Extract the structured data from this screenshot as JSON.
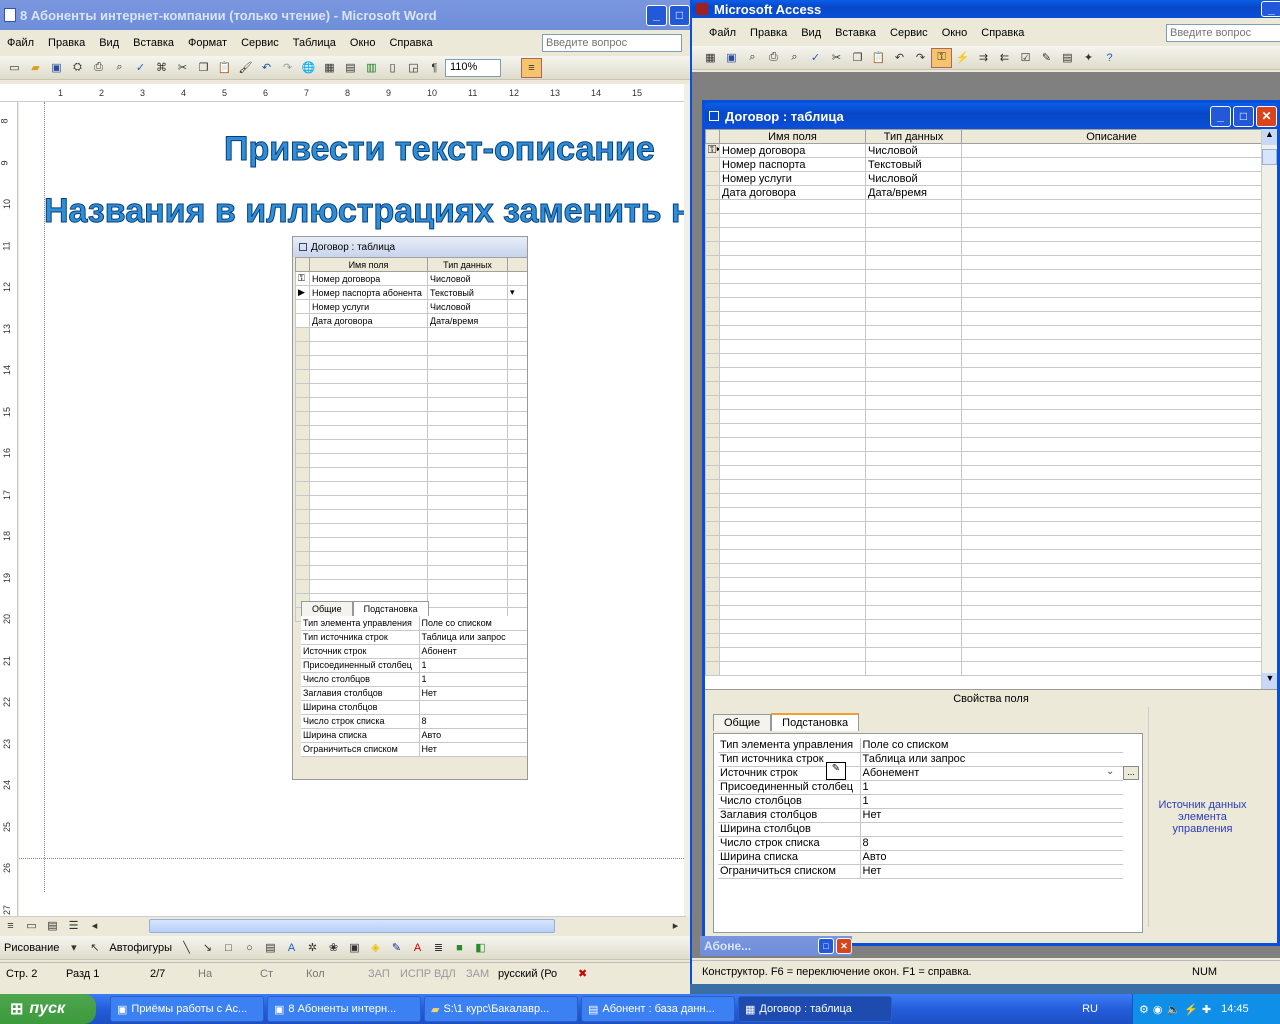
{
  "word": {
    "title": "8 Абоненты интернет-компании  (только чтение) - Microsoft Word",
    "menu": [
      "Файл",
      "Правка",
      "Вид",
      "Вставка",
      "Формат",
      "Сервис",
      "Таблица",
      "Окно",
      "Справка"
    ],
    "ask_placeholder": "Введите вопрос",
    "zoom": "110%",
    "heading1": "Привести текст-описание",
    "heading2": "Названия в иллюстрациях заменить на реа",
    "ruler_nums": [
      "1",
      "2",
      "3",
      "4",
      "5",
      "6",
      "7",
      "8",
      "9",
      "10",
      "11",
      "12",
      "13",
      "14",
      "15"
    ],
    "vruler_nums": [
      "8",
      "9",
      "10",
      "11",
      "12",
      "13",
      "14",
      "15",
      "16",
      "17",
      "18",
      "19",
      "20",
      "21",
      "22",
      "23",
      "24",
      "25",
      "26",
      "27"
    ],
    "embedded": {
      "title": "Договор : таблица",
      "col1": "Имя поля",
      "col2": "Тип данных",
      "rows": [
        {
          "name": "Номер договора",
          "type": "Числовой"
        },
        {
          "name": "Номер паспорта абонента",
          "type": "Текстовый"
        },
        {
          "name": "Номер услуги",
          "type": "Числовой"
        },
        {
          "name": "Дата договора",
          "type": "Дата/время"
        }
      ],
      "tab_general": "Общие",
      "tab_lookup": "Подстановка",
      "props": [
        {
          "k": "Тип элемента управления",
          "v": "Поле со списком"
        },
        {
          "k": "Тип источника строк",
          "v": "Таблица или запрос"
        },
        {
          "k": "Источник строк",
          "v": "Абонент"
        },
        {
          "k": "Присоединенный столбец",
          "v": "1"
        },
        {
          "k": "Число столбцов",
          "v": "1"
        },
        {
          "k": "Заглавия столбцов",
          "v": "Нет"
        },
        {
          "k": "Ширина столбцов",
          "v": ""
        },
        {
          "k": "Число строк списка",
          "v": "8"
        },
        {
          "k": "Ширина списка",
          "v": "Авто"
        },
        {
          "k": "Ограничиться списком",
          "v": "Нет"
        }
      ]
    },
    "drawing": "Рисование",
    "autoshapes": "Автофигуры",
    "status": [
      "Стр.  2",
      "Разд  1",
      "2/7",
      "На",
      "Ст",
      "Кол",
      "ЗАП",
      "ИСПР",
      "ВДЛ",
      "ЗАМ",
      "русский (Ро"
    ]
  },
  "access": {
    "title": "Microsoft Access",
    "menu": [
      "Файл",
      "Правка",
      "Вид",
      "Вставка",
      "Сервис",
      "Окно",
      "Справка"
    ],
    "ask_placeholder": "Введите вопрос",
    "table": {
      "title": "Договор : таблица",
      "col1": "Имя поля",
      "col2": "Тип данных",
      "col3": "Описание",
      "rows": [
        {
          "name": "Номер договора",
          "type": "Числовой"
        },
        {
          "name": "Номер паспорта",
          "type": "Текстовый"
        },
        {
          "name": "Номер услуги",
          "type": "Числовой"
        },
        {
          "name": "Дата договора",
          "type": "Дата/время"
        }
      ],
      "props_header": "Свойства поля",
      "tab_general": "Общие",
      "tab_lookup": "Подстановка",
      "props": [
        {
          "k": "Тип элемента управления",
          "v": "Поле со списком"
        },
        {
          "k": "Тип источника строк",
          "v": "Таблица или запрос"
        },
        {
          "k": "Источник строк",
          "v": "Абонемент"
        },
        {
          "k": "Присоединенный столбец",
          "v": "1"
        },
        {
          "k": "Число столбцов",
          "v": "1"
        },
        {
          "k": "Заглавия столбцов",
          "v": "Нет"
        },
        {
          "k": "Ширина столбцов",
          "v": ""
        },
        {
          "k": "Число строк списка",
          "v": "8"
        },
        {
          "k": "Ширина списка",
          "v": "Авто"
        },
        {
          "k": "Ограничиться списком",
          "v": "Нет"
        }
      ],
      "hint": "Источник данных элемента управления"
    },
    "minimized": "Абоне...",
    "status": "Конструктор.  F6 = переключение окон.  F1 = справка.",
    "num": "NUM"
  },
  "taskbar": {
    "start": "пуск",
    "buttons": [
      "Приёмы работы с Ас...",
      "8 Абоненты интерн...",
      "S:\\1 курс\\Бакалавр...",
      "Абонент : база данн...",
      "Договор : таблица"
    ],
    "lang": "RU",
    "clock": "14:45"
  },
  "colors": {
    "title_blue": "#0a4fd8",
    "taskbar": "#245edb",
    "start_green": "#3c9a3c",
    "heading": "#2d8fd8"
  }
}
